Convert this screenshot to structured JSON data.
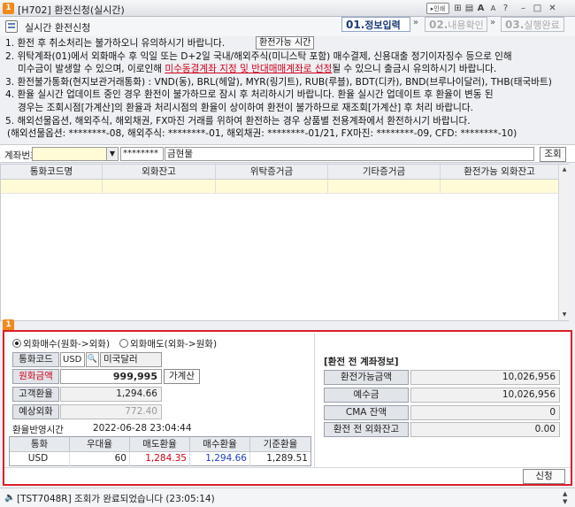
{
  "window": {
    "badge": "1",
    "title": "[H702] 환전신청(실시간)",
    "controls": {
      "search": "▸인쇄",
      "pin": "⊞",
      "tile": "▤",
      "text_up": "A",
      "text_down": "A",
      "help": "?",
      "minimize": "–",
      "maximize": "□",
      "close": "✕"
    }
  },
  "header": {
    "title": "실시간 환전신청",
    "steps": [
      {
        "num": "01.",
        "label": "정보입력"
      },
      {
        "num": "02.",
        "label": "내용확인"
      },
      {
        "num": "03.",
        "label": "실행완료"
      }
    ],
    "chevron": "»"
  },
  "notices": {
    "n1": "1. 환전 후 취소처리는 불가하오니 유의하시기 바랍니다.",
    "n1_button": "환전가능 시간",
    "n2a": "2. 위탁계좌(01)에서 외화매수 후 익일 또는 D+2일 국내/해외주식(미니스탁 포함) 매수결제, 신용대출 정기이자징수 등으로 인해",
    "n2b_pre": "미수금이 발생할 수 있으며, 이로인해 ",
    "n2b_red": "미수동결계좌 지정 및 반대매매계좌로 선정",
    "n2b_post": "될 수 있으니 출금시 유의하시기 바랍니다.",
    "n3": "3. 환전불가통화(현지보관거래통화) : VND(동), BRL(헤알), MYR(링기트), RUB(루블), BDT(디카), BND(브루나이달러), THB(태국바트)",
    "n4a": "4. 환율 실시간 업데이트 중인 경우 환전이 불가하므로 잠시 후 처리하시기 바랍니다. 환율 실시간 업데이트 후 환율이 변동 된",
    "n4b": "경우는 조회시점[가계산]의 환율과 처리시점의 환율이 상이하여 환전이 불가하므로 재조회[가계산] 후 처리 바랍니다.",
    "n5a": "5. 해외선물옵션, 해외주식, 해외채권, FX마진 거래를 위하여 환전하는 경우 상품별 전용계좌에서 환전하시기 바랍니다.",
    "n5b": "(해외선물옵션: ********-08, 해외주식: ********-01, 해외채권: ********-01/21, FX마진: ********-09, CFD: ********-10)"
  },
  "account": {
    "label": "계좌번호",
    "number": "",
    "password": "********",
    "type_name": "금현물",
    "query_button": "조회"
  },
  "grid": {
    "columns": [
      "통화코드명",
      "외화잔고",
      "위탁증거금",
      "기타증거금",
      "환전가능 외화잔고"
    ],
    "rows": []
  },
  "panel": {
    "badge": "1",
    "radio_buy": "외화매수(원화->외화)",
    "radio_sell": "외화매도(외화->원화)",
    "selected": "buy",
    "currency_code_label": "통화코드",
    "currency_code": "USD",
    "currency_name": "미국달러",
    "krw_amount_label": "원화금액",
    "krw_amount": "999,995",
    "calc_button": "가계산",
    "customer_rate_label": "고객환율",
    "customer_rate": "1,294.66",
    "expected_fx_label": "예상외화",
    "expected_fx": "772.40",
    "reflect_time_label": "환율반영시간",
    "reflect_time": "2022-06-28 23:04:44",
    "rate_table": {
      "columns": [
        "통화",
        "우대율",
        "매도환율",
        "매수환율",
        "기준환율"
      ],
      "row": {
        "currency": "USD",
        "preferential": "60",
        "sell_rate": "1,284.35",
        "buy_rate": "1,294.66",
        "base_rate": "1,289.51"
      }
    },
    "pre_info": {
      "title": "[환전 전 계좌정보]",
      "rows": [
        {
          "label": "환전가능금액",
          "value": "10,026,956"
        },
        {
          "label": "예수금",
          "value": "10,026,956"
        },
        {
          "label": "CMA 잔액",
          "value": "0"
        },
        {
          "label": "환전 전 외화잔고",
          "value": "0.00"
        }
      ]
    },
    "apply_button": "신청"
  },
  "status": {
    "icon": "🔈",
    "message": "[TST7048R] 조회가 완료되었습니다 (23:05:14)",
    "scroll_up": "▲",
    "scroll_down": "▼"
  },
  "colors": {
    "highlight_border": "#d9202a",
    "sell_rate": "#d0021b",
    "buy_rate": "#1a3fc2",
    "row_highlight": "#fffbd6",
    "badge": "#f08a1c"
  }
}
